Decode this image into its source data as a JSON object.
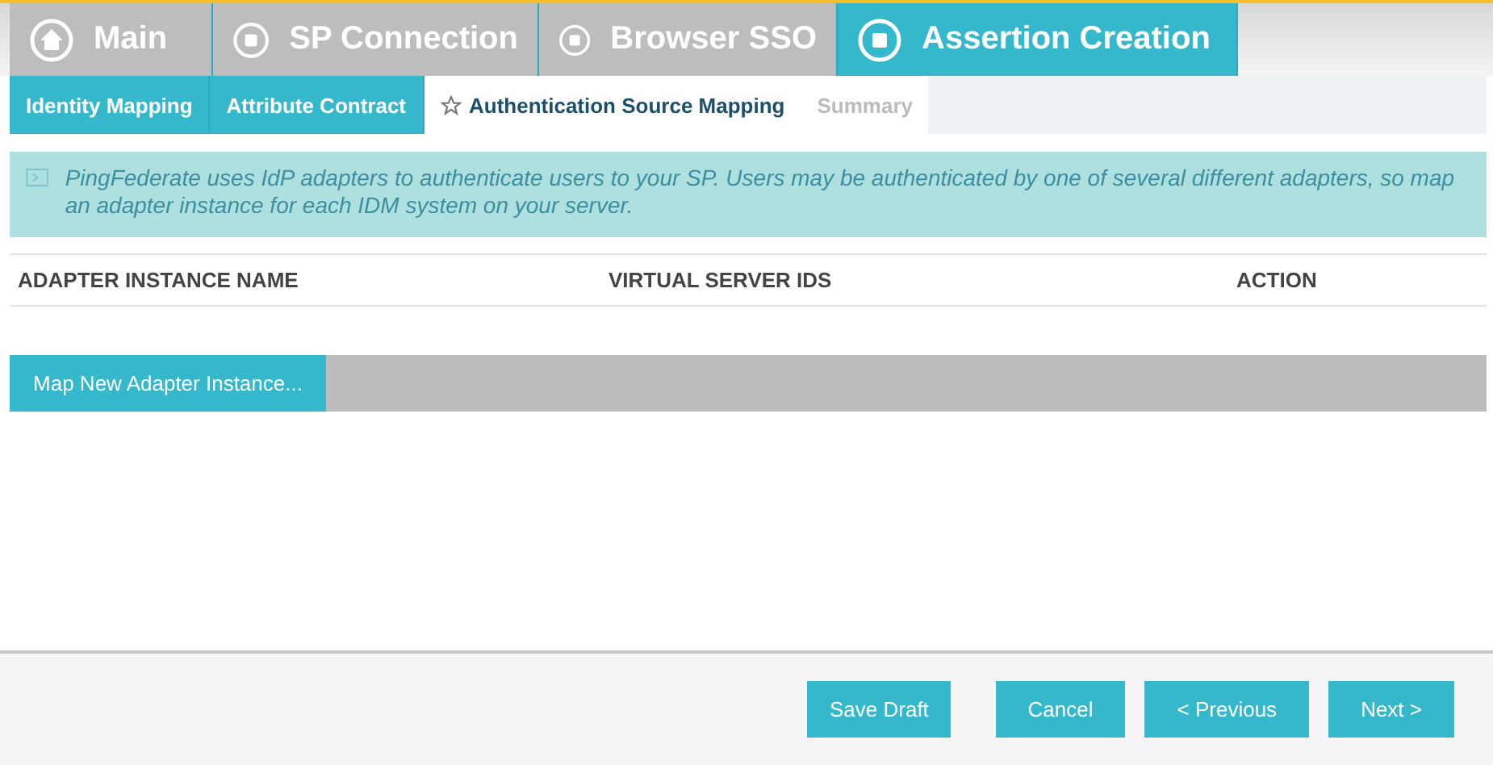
{
  "main_tabs": [
    {
      "label": "Main",
      "kind": "home",
      "selected": false
    },
    {
      "label": "SP Connection",
      "kind": "step",
      "selected": false
    },
    {
      "label": "Browser SSO",
      "kind": "step",
      "selected": false
    },
    {
      "label": "Assertion Creation",
      "kind": "step",
      "selected": true
    }
  ],
  "sub_tabs": [
    {
      "label": "Identity Mapping",
      "selected": false,
      "completed": true
    },
    {
      "label": "Attribute Contract",
      "selected": false,
      "completed": true
    },
    {
      "label": "Authentication Source Mapping",
      "selected": true,
      "completed": false
    },
    {
      "label": "Summary",
      "selected": false,
      "completed": false
    }
  ],
  "info": "PingFederate uses IdP adapters to authenticate users to your SP. Users may be authenticated by one of several different adapters, so map an adapter instance for each IDM system on your server.",
  "table": {
    "columns": [
      "ADAPTER INSTANCE NAME",
      "VIRTUAL SERVER IDS",
      "ACTION"
    ]
  },
  "map_button": "Map New Adapter Instance...",
  "footer": {
    "save": "Save Draft",
    "buttons": [
      "Cancel",
      "< Previous",
      "Next >"
    ]
  }
}
